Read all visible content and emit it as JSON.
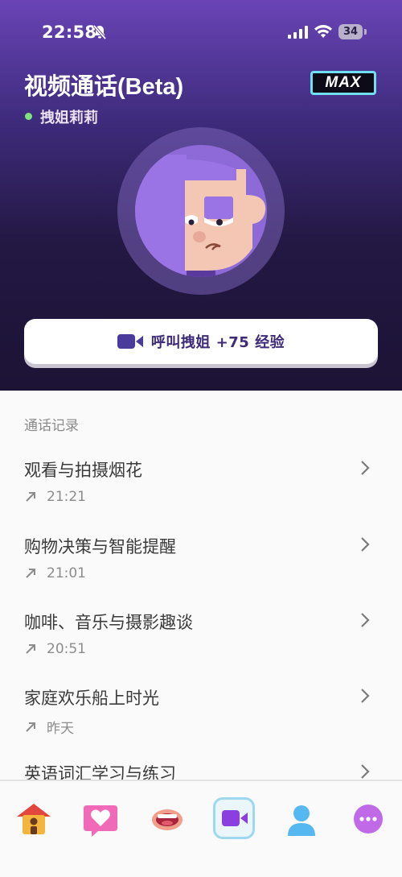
{
  "status_bar": {
    "time": "22:58",
    "battery": "34"
  },
  "header": {
    "title": "视频通话(Beta)",
    "badge": "MAX",
    "character_name": "拽姐莉莉"
  },
  "call_button": {
    "label": "呼叫拽姐 +75 经验"
  },
  "history": {
    "section_label": "通话记录",
    "items": [
      {
        "title": "观看与拍摄烟花",
        "time": "21:21"
      },
      {
        "title": "购物决策与智能提醒",
        "time": "21:01"
      },
      {
        "title": "咖啡、音乐与摄影趣谈",
        "time": "20:51"
      },
      {
        "title": "家庭欢乐船上时光",
        "time": "昨天"
      },
      {
        "title": "英语词汇学习与练习",
        "time": ""
      }
    ]
  },
  "tab_bar": {
    "tabs": [
      {
        "icon": "home-icon"
      },
      {
        "icon": "heart-icon"
      },
      {
        "icon": "mouth-icon"
      },
      {
        "icon": "video-icon",
        "active": true
      },
      {
        "icon": "profile-icon"
      },
      {
        "icon": "more-icon"
      }
    ]
  },
  "colors": {
    "accent": "#4a3a9a",
    "active_tab_border": "#9ed8ee",
    "online": "#7ee27e"
  }
}
